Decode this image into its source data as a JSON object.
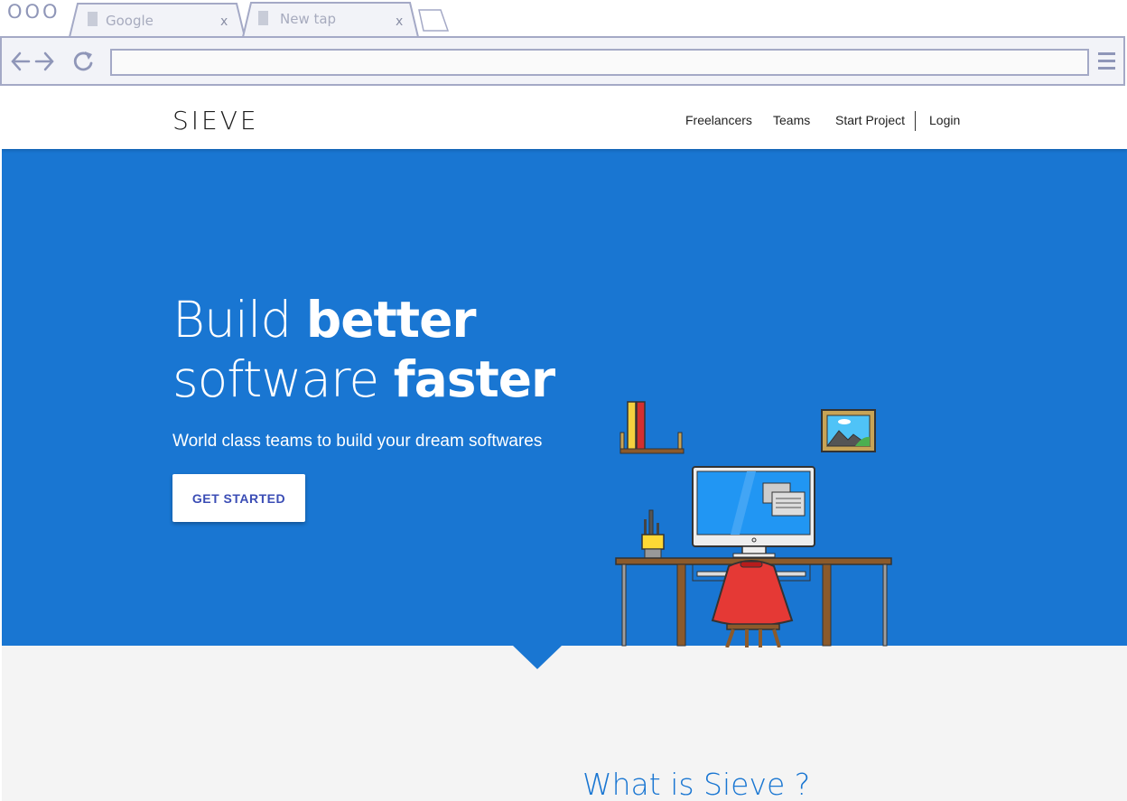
{
  "browser": {
    "window_controls": "OOO",
    "tabs": [
      {
        "label": "Google",
        "close": "x"
      },
      {
        "label": "New tap",
        "close": "x"
      }
    ],
    "address_value": "",
    "icons": [
      "back-arrow-icon",
      "forward-arrow-icon",
      "reload-icon",
      "menu-icon",
      "new-tab-icon"
    ]
  },
  "site": {
    "logo": "SIEVE",
    "nav": [
      "Freelancers",
      "Teams",
      "Start Project",
      "Login"
    ]
  },
  "hero": {
    "headline_line1_light": "Build ",
    "headline_line1_bold": "better",
    "headline_line2_light": "software ",
    "headline_line2_bold": "faster",
    "subtitle": "World class teams to build your dream softwares",
    "cta": "GET STARTED",
    "background_color": "#1976d2"
  },
  "section": {
    "title": "What is Sieve ?"
  }
}
